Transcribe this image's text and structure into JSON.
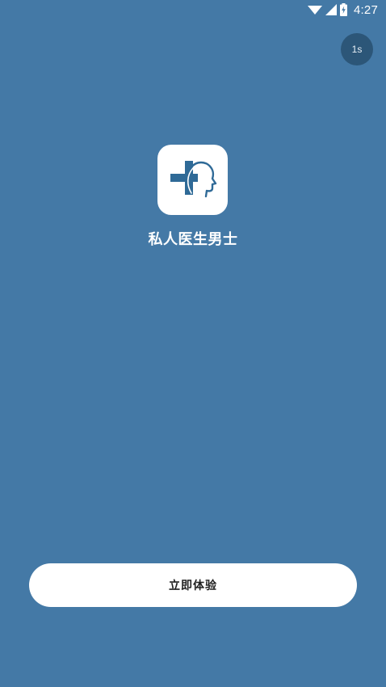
{
  "status_bar": {
    "time": "4:27",
    "icons": [
      "wifi-icon",
      "signal-icon",
      "battery-charging-icon"
    ]
  },
  "skip": {
    "countdown": "1s"
  },
  "app": {
    "name": "私人医生男士",
    "logo_icon": "cross-head-logo"
  },
  "cta": {
    "label": "立即体验"
  },
  "colors": {
    "background": "#4479a6",
    "skip_badge": "#2c5678",
    "button_bg": "#ffffff"
  }
}
